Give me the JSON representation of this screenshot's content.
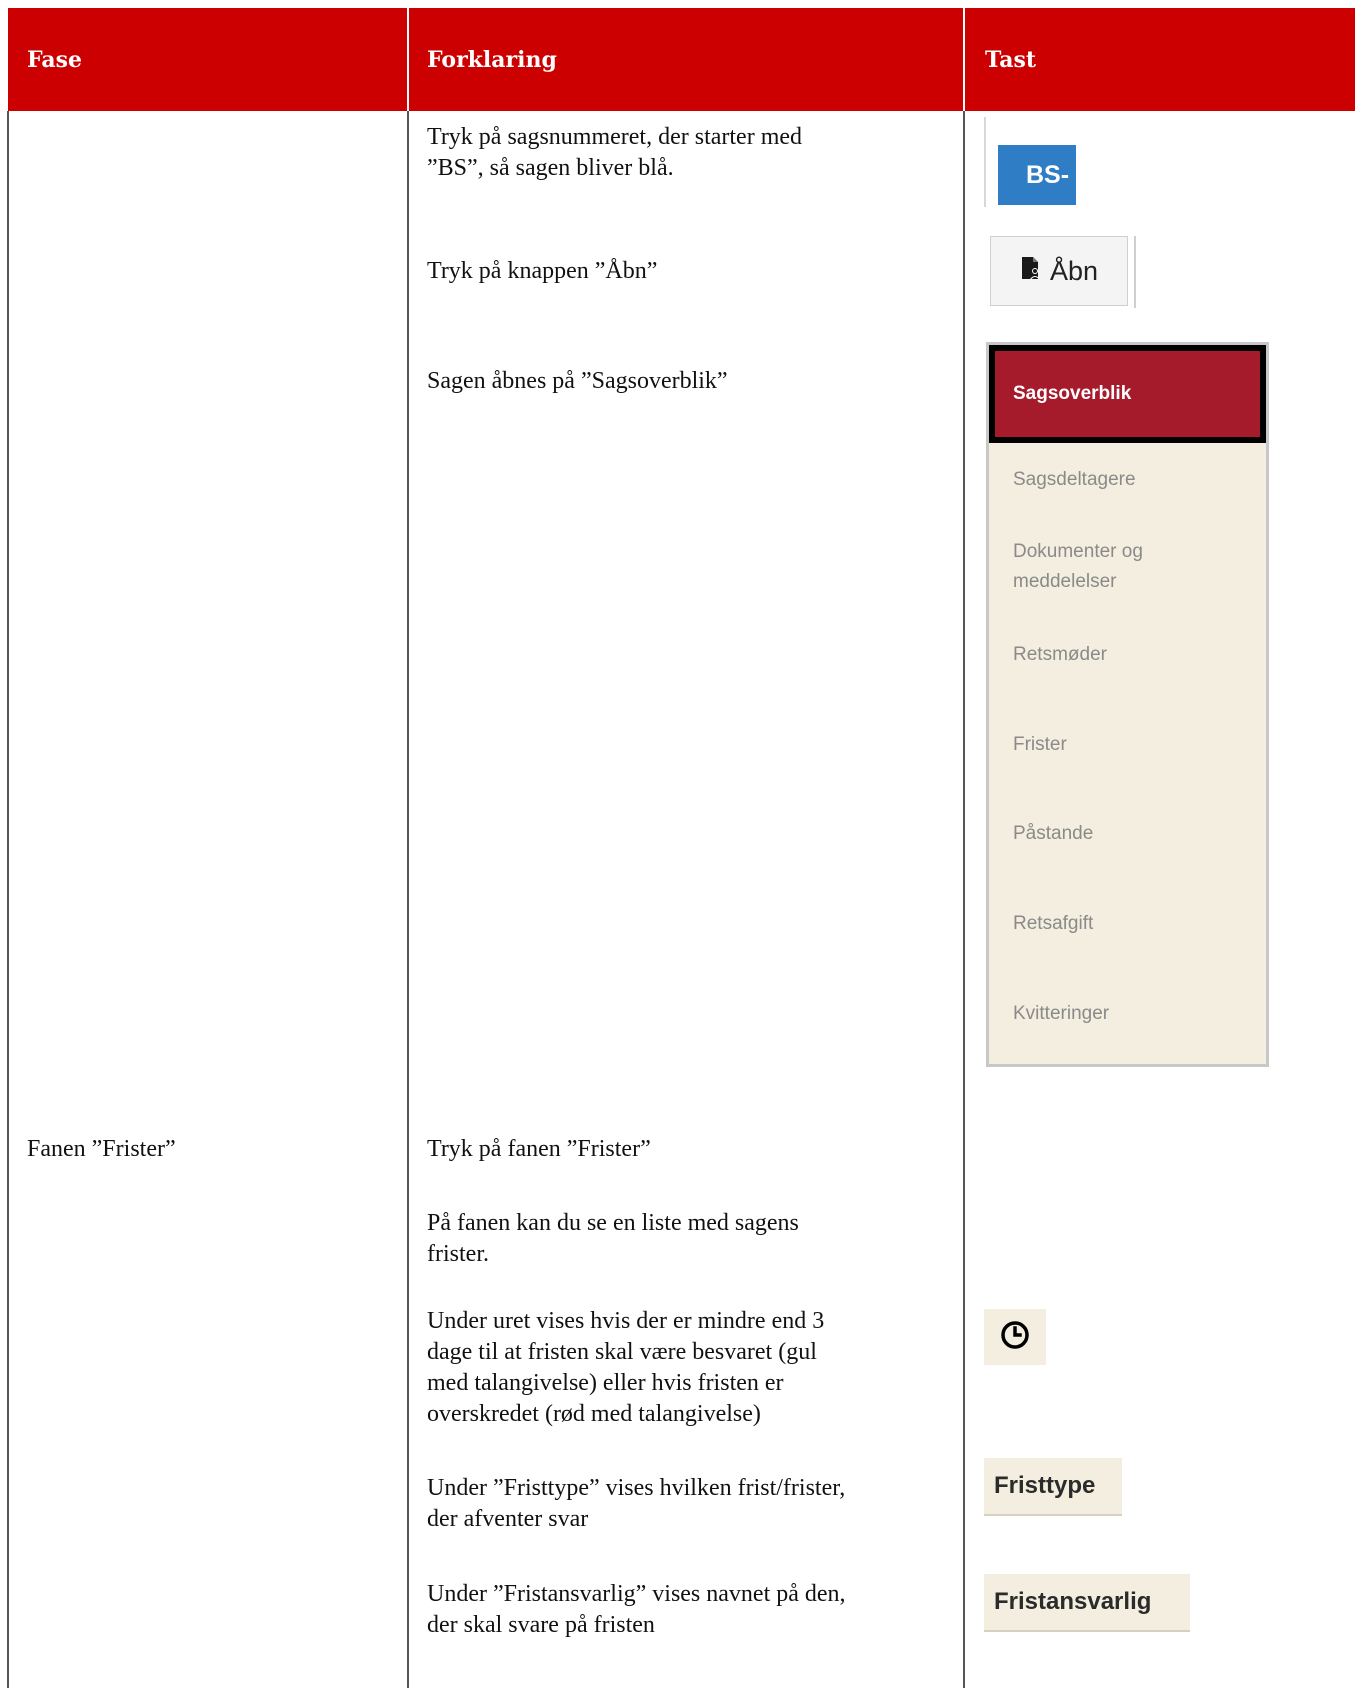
{
  "header": {
    "col1": "Fase",
    "col2": "Forklaring",
    "col3": "Tast"
  },
  "rows": {
    "r1_text_line1": "Tryk på sagsnummeret, der starter med",
    "r1_text_line2": "”BS”, så sagen bliver blå.",
    "r2_text": "Tryk på knappen ”Åbn”",
    "r3_text": "Sagen åbnes på ”Sagsoverblik”",
    "phase_frister": "Fanen ”Frister”",
    "r4_text": "Tryk på fanen ”Frister”",
    "r5_line1": "På fanen kan du se en liste med sagens",
    "r5_line2": "frister.",
    "r6_line1": "Under uret vises hvis der er mindre end 3",
    "r6_line2": "dage til at fristen skal være besvaret (gul",
    "r6_line3": "med talangivelse) eller hvis fristen er",
    "r6_line4": "overskredet (rød med talangivelse)",
    "r7_line1": "Under ”Fristtype” vises hvilken frist/frister,",
    "r7_line2": "der afventer svar",
    "r8_line1": "Under ”Fristansvarlig” vises navnet på den,",
    "r8_line2": "der skal svare på fristen"
  },
  "tast": {
    "bs_label": "BS-",
    "abn_label": "Åbn",
    "nav": {
      "active": "Sagsoverblik",
      "items": [
        "Sagsdeltagere",
        "Dokumenter og",
        "meddelelser",
        "Retsmøder",
        "Frister",
        "Påstande",
        "Retsafgift",
        "Kvitteringer"
      ]
    },
    "fristtype_label": "Fristtype",
    "fristansvarlig_label": "Fristansvarlig"
  },
  "colors": {
    "header_red": "#cc0000",
    "active_tab": "#a61b2c",
    "panel_bg": "#f3eedf",
    "bs_blue": "#2f7dc5"
  },
  "icons": [
    "document-person-icon",
    "clock-icon"
  ]
}
